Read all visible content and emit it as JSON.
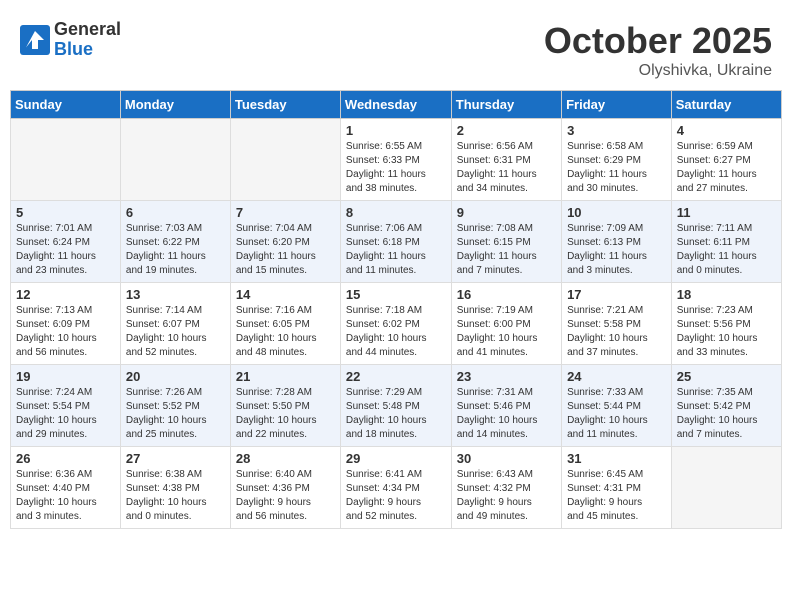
{
  "header": {
    "logo_general": "General",
    "logo_blue": "Blue",
    "month": "October 2025",
    "location": "Olyshivka, Ukraine"
  },
  "days_of_week": [
    "Sunday",
    "Monday",
    "Tuesday",
    "Wednesday",
    "Thursday",
    "Friday",
    "Saturday"
  ],
  "weeks": [
    [
      {
        "day": "",
        "info": ""
      },
      {
        "day": "",
        "info": ""
      },
      {
        "day": "",
        "info": ""
      },
      {
        "day": "1",
        "info": "Sunrise: 6:55 AM\nSunset: 6:33 PM\nDaylight: 11 hours\nand 38 minutes."
      },
      {
        "day": "2",
        "info": "Sunrise: 6:56 AM\nSunset: 6:31 PM\nDaylight: 11 hours\nand 34 minutes."
      },
      {
        "day": "3",
        "info": "Sunrise: 6:58 AM\nSunset: 6:29 PM\nDaylight: 11 hours\nand 30 minutes."
      },
      {
        "day": "4",
        "info": "Sunrise: 6:59 AM\nSunset: 6:27 PM\nDaylight: 11 hours\nand 27 minutes."
      }
    ],
    [
      {
        "day": "5",
        "info": "Sunrise: 7:01 AM\nSunset: 6:24 PM\nDaylight: 11 hours\nand 23 minutes."
      },
      {
        "day": "6",
        "info": "Sunrise: 7:03 AM\nSunset: 6:22 PM\nDaylight: 11 hours\nand 19 minutes."
      },
      {
        "day": "7",
        "info": "Sunrise: 7:04 AM\nSunset: 6:20 PM\nDaylight: 11 hours\nand 15 minutes."
      },
      {
        "day": "8",
        "info": "Sunrise: 7:06 AM\nSunset: 6:18 PM\nDaylight: 11 hours\nand 11 minutes."
      },
      {
        "day": "9",
        "info": "Sunrise: 7:08 AM\nSunset: 6:15 PM\nDaylight: 11 hours\nand 7 minutes."
      },
      {
        "day": "10",
        "info": "Sunrise: 7:09 AM\nSunset: 6:13 PM\nDaylight: 11 hours\nand 3 minutes."
      },
      {
        "day": "11",
        "info": "Sunrise: 7:11 AM\nSunset: 6:11 PM\nDaylight: 11 hours\nand 0 minutes."
      }
    ],
    [
      {
        "day": "12",
        "info": "Sunrise: 7:13 AM\nSunset: 6:09 PM\nDaylight: 10 hours\nand 56 minutes."
      },
      {
        "day": "13",
        "info": "Sunrise: 7:14 AM\nSunset: 6:07 PM\nDaylight: 10 hours\nand 52 minutes."
      },
      {
        "day": "14",
        "info": "Sunrise: 7:16 AM\nSunset: 6:05 PM\nDaylight: 10 hours\nand 48 minutes."
      },
      {
        "day": "15",
        "info": "Sunrise: 7:18 AM\nSunset: 6:02 PM\nDaylight: 10 hours\nand 44 minutes."
      },
      {
        "day": "16",
        "info": "Sunrise: 7:19 AM\nSunset: 6:00 PM\nDaylight: 10 hours\nand 41 minutes."
      },
      {
        "day": "17",
        "info": "Sunrise: 7:21 AM\nSunset: 5:58 PM\nDaylight: 10 hours\nand 37 minutes."
      },
      {
        "day": "18",
        "info": "Sunrise: 7:23 AM\nSunset: 5:56 PM\nDaylight: 10 hours\nand 33 minutes."
      }
    ],
    [
      {
        "day": "19",
        "info": "Sunrise: 7:24 AM\nSunset: 5:54 PM\nDaylight: 10 hours\nand 29 minutes."
      },
      {
        "day": "20",
        "info": "Sunrise: 7:26 AM\nSunset: 5:52 PM\nDaylight: 10 hours\nand 25 minutes."
      },
      {
        "day": "21",
        "info": "Sunrise: 7:28 AM\nSunset: 5:50 PM\nDaylight: 10 hours\nand 22 minutes."
      },
      {
        "day": "22",
        "info": "Sunrise: 7:29 AM\nSunset: 5:48 PM\nDaylight: 10 hours\nand 18 minutes."
      },
      {
        "day": "23",
        "info": "Sunrise: 7:31 AM\nSunset: 5:46 PM\nDaylight: 10 hours\nand 14 minutes."
      },
      {
        "day": "24",
        "info": "Sunrise: 7:33 AM\nSunset: 5:44 PM\nDaylight: 10 hours\nand 11 minutes."
      },
      {
        "day": "25",
        "info": "Sunrise: 7:35 AM\nSunset: 5:42 PM\nDaylight: 10 hours\nand 7 minutes."
      }
    ],
    [
      {
        "day": "26",
        "info": "Sunrise: 6:36 AM\nSunset: 4:40 PM\nDaylight: 10 hours\nand 3 minutes."
      },
      {
        "day": "27",
        "info": "Sunrise: 6:38 AM\nSunset: 4:38 PM\nDaylight: 10 hours\nand 0 minutes."
      },
      {
        "day": "28",
        "info": "Sunrise: 6:40 AM\nSunset: 4:36 PM\nDaylight: 9 hours\nand 56 minutes."
      },
      {
        "day": "29",
        "info": "Sunrise: 6:41 AM\nSunset: 4:34 PM\nDaylight: 9 hours\nand 52 minutes."
      },
      {
        "day": "30",
        "info": "Sunrise: 6:43 AM\nSunset: 4:32 PM\nDaylight: 9 hours\nand 49 minutes."
      },
      {
        "day": "31",
        "info": "Sunrise: 6:45 AM\nSunset: 4:31 PM\nDaylight: 9 hours\nand 45 minutes."
      },
      {
        "day": "",
        "info": ""
      }
    ]
  ]
}
